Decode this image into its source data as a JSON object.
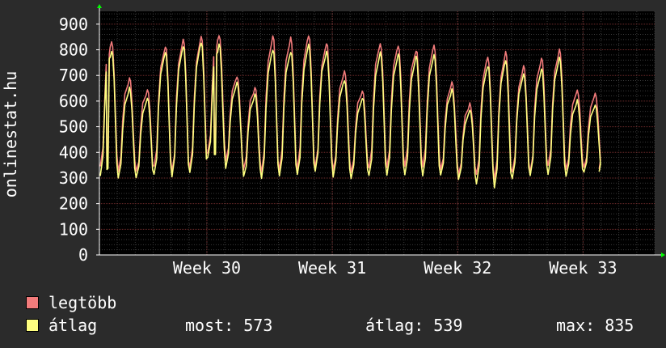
{
  "colors": {
    "background": "#2b2b2b",
    "plot_background": "#000000",
    "grid_major": "#6e2b2b",
    "grid_minor": "#3a3a3a",
    "axis": "#ffffff",
    "legtobb": "#f27b7b",
    "atlag": "#ffff80",
    "arrow": "#00ff00"
  },
  "legend": {
    "legtobb_label": "legtöbb",
    "atlag_label": "átlag",
    "most_label": "most:",
    "most_value": "573",
    "atlag_stat_label": "átlag:",
    "atlag_stat_value": "539",
    "max_label": "max:",
    "max_value": "835"
  },
  "chart_data": {
    "type": "line",
    "ylabel": "onlinestat.hu",
    "xlabel": "",
    "title": "",
    "ylim": [
      0,
      950
    ],
    "yticks": [
      0,
      100,
      200,
      300,
      400,
      500,
      600,
      700,
      800,
      900
    ],
    "xlim": [
      0,
      31
    ],
    "xticks": [
      {
        "label": "Week 30",
        "x": 6.0
      },
      {
        "label": "Week 31",
        "x": 13.0
      },
      {
        "label": "Week 32",
        "x": 20.0
      },
      {
        "label": "Week 33",
        "x": 27.0
      }
    ],
    "grid": true,
    "legend_position": "bottom-left",
    "series": [
      {
        "name": "legtöbb",
        "days": [
          {
            "max": 830,
            "min": 345,
            "noon": 350
          },
          {
            "max": 690,
            "min": 330
          },
          {
            "max": 645,
            "min": 320
          },
          {
            "max": 815,
            "min": 340
          },
          {
            "max": 840,
            "min": 320
          },
          {
            "max": 850,
            "min": 345
          },
          {
            "max": 860,
            "min": 400,
            "noon": 425
          },
          {
            "max": 700,
            "min": 360
          },
          {
            "max": 655,
            "min": 330
          },
          {
            "max": 850,
            "min": 320
          },
          {
            "max": 845,
            "min": 330
          },
          {
            "max": 860,
            "min": 335
          },
          {
            "max": 830,
            "min": 345
          },
          {
            "max": 715,
            "min": 330
          },
          {
            "max": 645,
            "min": 325
          },
          {
            "max": 825,
            "min": 340
          },
          {
            "max": 815,
            "min": 335
          },
          {
            "max": 800,
            "min": 345
          },
          {
            "max": 815,
            "min": 340
          },
          {
            "max": 675,
            "min": 330
          },
          {
            "max": 590,
            "min": 320
          },
          {
            "max": 770,
            "min": 310
          },
          {
            "max": 790,
            "min": 295
          },
          {
            "max": 735,
            "min": 325
          },
          {
            "max": 765,
            "min": 325
          },
          {
            "max": 800,
            "min": 345
          },
          {
            "max": 640,
            "min": 335
          },
          {
            "max": 630,
            "min": 335
          }
        ]
      },
      {
        "name": "átlag",
        "days": [
          {
            "max": 800,
            "min": 315,
            "noon": 330
          },
          {
            "max": 650,
            "min": 300
          },
          {
            "max": 615,
            "min": 300
          },
          {
            "max": 790,
            "min": 310
          },
          {
            "max": 815,
            "min": 300
          },
          {
            "max": 825,
            "min": 320
          },
          {
            "max": 820,
            "min": 375,
            "noon": 385
          },
          {
            "max": 670,
            "min": 340
          },
          {
            "max": 625,
            "min": 300
          },
          {
            "max": 800,
            "min": 300
          },
          {
            "max": 795,
            "min": 305
          },
          {
            "max": 820,
            "min": 310
          },
          {
            "max": 795,
            "min": 320
          },
          {
            "max": 685,
            "min": 305
          },
          {
            "max": 615,
            "min": 300
          },
          {
            "max": 790,
            "min": 310
          },
          {
            "max": 785,
            "min": 305
          },
          {
            "max": 770,
            "min": 315
          },
          {
            "max": 780,
            "min": 305
          },
          {
            "max": 645,
            "min": 305
          },
          {
            "max": 565,
            "min": 295
          },
          {
            "max": 740,
            "min": 280
          },
          {
            "max": 755,
            "min": 265
          },
          {
            "max": 705,
            "min": 300
          },
          {
            "max": 725,
            "min": 305
          },
          {
            "max": 765,
            "min": 315
          },
          {
            "max": 600,
            "min": 305
          },
          {
            "max": 580,
            "min": 330
          }
        ]
      }
    ]
  }
}
